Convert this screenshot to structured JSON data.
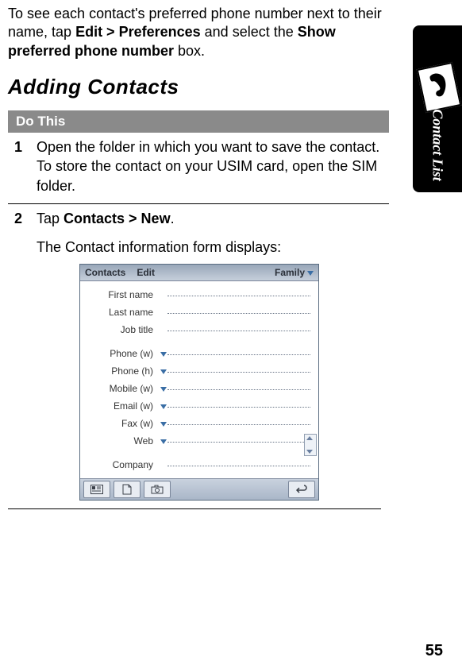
{
  "intro": {
    "pre": "To see each contact's preferred phone number next to their name, tap ",
    "bold1": "Edit > Preferences",
    "mid": " and select the ",
    "bold2": "Show preferred phone number",
    "post": " box."
  },
  "section_title": "Adding Contacts",
  "do_this_label": "Do This",
  "steps": [
    {
      "num": "1",
      "text": "Open the folder in which you want to save the contact. To store the contact on your USIM card, open the SIM folder."
    },
    {
      "num": "2",
      "pre": "Tap ",
      "bold": "Contacts > New",
      "post": ".",
      "caption": "The Contact information form displays:"
    }
  ],
  "side_label": "Contact List",
  "page_number": "55",
  "phone": {
    "menu": {
      "contacts": "Contacts",
      "edit": "Edit",
      "category": "Family"
    },
    "fields": [
      {
        "label": "First name",
        "dd": false
      },
      {
        "label": "Last name",
        "dd": false
      },
      {
        "label": "Job title",
        "dd": false,
        "gap": true
      },
      {
        "label": "Phone (w)",
        "dd": true
      },
      {
        "label": "Phone (h)",
        "dd": true
      },
      {
        "label": "Mobile (w)",
        "dd": true
      },
      {
        "label": "Email (w)",
        "dd": true
      },
      {
        "label": "Fax (w)",
        "dd": true
      },
      {
        "label": "Web",
        "dd": true,
        "gap": true
      },
      {
        "label": "Company",
        "dd": false
      }
    ]
  }
}
